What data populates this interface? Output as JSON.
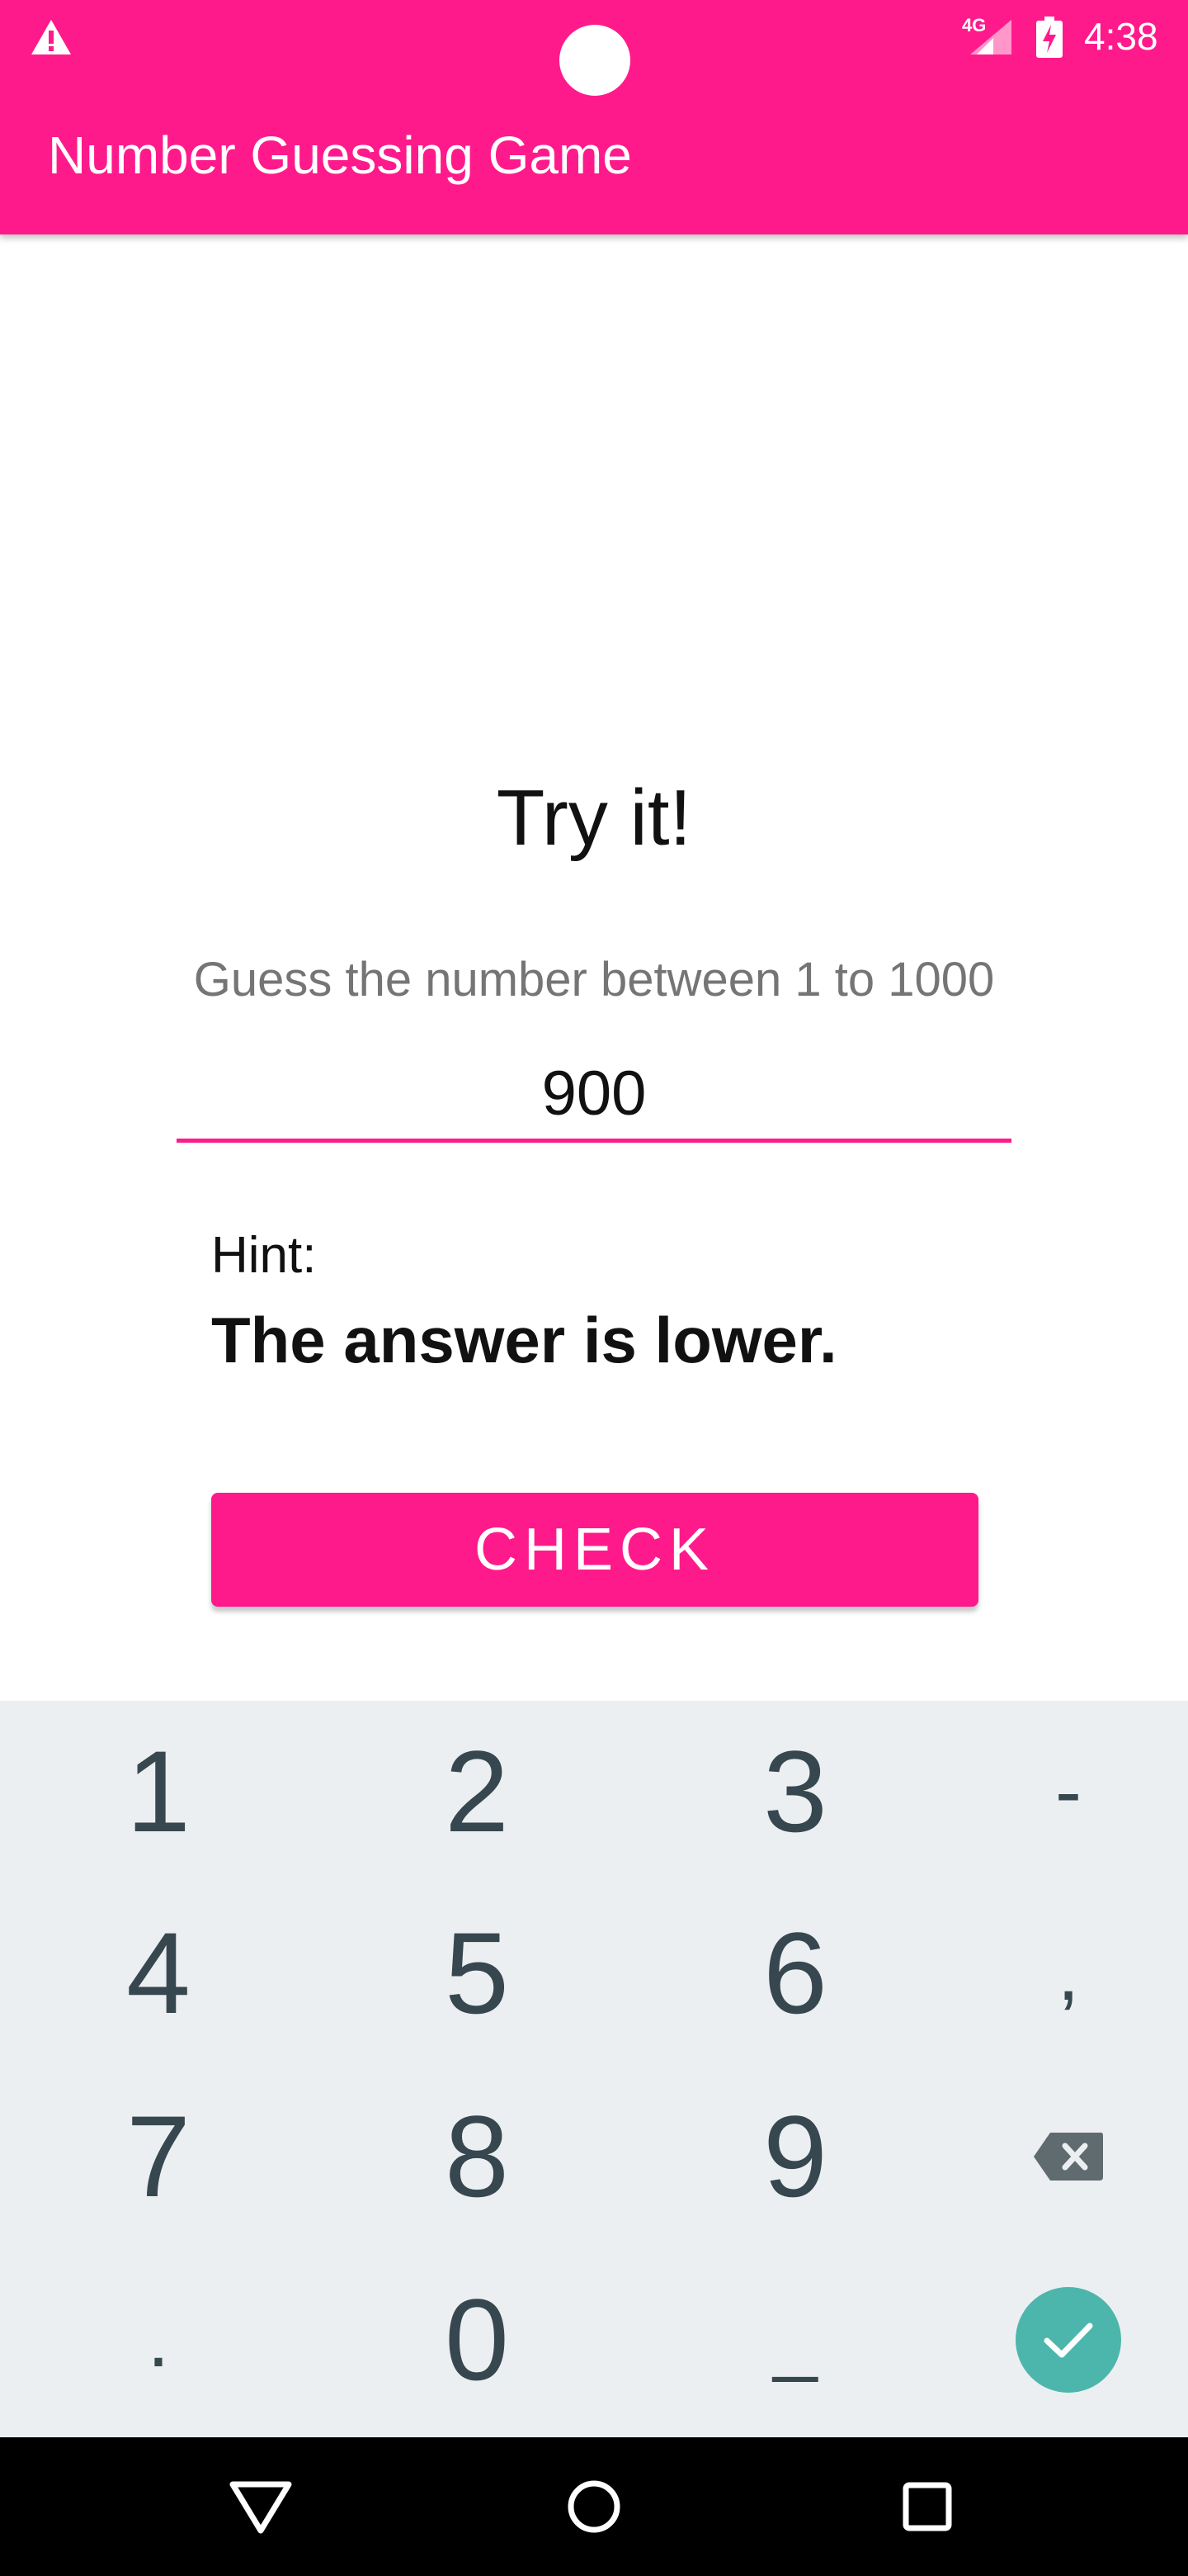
{
  "status_bar": {
    "network_type": "4G",
    "time": "4:38",
    "icons": [
      "warning-icon",
      "signal-icon",
      "battery-charging-icon"
    ]
  },
  "app_bar": {
    "title": "Number Guessing Game"
  },
  "main": {
    "heading": "Try it!",
    "instruction": "Guess the number between 1 to 1000",
    "guess_value": "900",
    "hint_label": "Hint:",
    "hint_text": "The answer is lower.",
    "check_label": "CHECK"
  },
  "keyboard": {
    "keys": [
      "1",
      "2",
      "3",
      "-",
      "4",
      "5",
      "6",
      ",",
      "7",
      "8",
      "9",
      ".",
      "0",
      "_"
    ],
    "action_icons": [
      "backspace-icon",
      "done-check-icon"
    ]
  },
  "nav_bar": {
    "icons": [
      "back-icon",
      "home-icon",
      "recents-icon"
    ]
  },
  "colors": {
    "accent": "#FF1A8C",
    "keyboard_bg": "#ECEFF1",
    "key_text": "#37474F",
    "done_button": "#4DB6AC"
  }
}
